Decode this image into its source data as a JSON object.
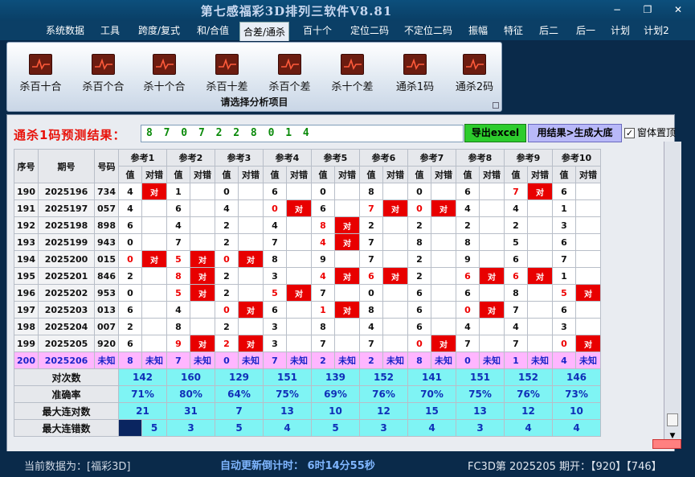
{
  "window": {
    "title": "第七感福彩3D排列三软件V8.81",
    "min": "−",
    "restore": "❐",
    "close": "✕"
  },
  "menu": [
    "系统数据",
    "工具",
    "跨度/复式",
    "和/合值",
    "合差/通杀",
    "百十个",
    "定位二码",
    "不定位二码",
    "振幅",
    "特征",
    "后二",
    "后一",
    "计划",
    "计划2"
  ],
  "menu_active": 4,
  "ribbon": {
    "buttons": [
      "杀百十合",
      "杀百个合",
      "杀十个合",
      "杀百十差",
      "杀百个差",
      "杀十个差",
      "通杀1码",
      "通杀2码"
    ],
    "caption": "请选择分析项目"
  },
  "result": {
    "label": "通杀1码预测结果：",
    "value": "8 7 0 7 2 2 8 0 1 4",
    "export_btn": "导出excel",
    "gen_btn": "用结果>生成大底",
    "topmost_label": "窗体置顶",
    "topmost_checked": "✓"
  },
  "table": {
    "headers": {
      "seq": "序号",
      "period": "期号",
      "number": "号码",
      "value": "值",
      "check": "对错"
    },
    "refs": [
      "参考1",
      "参考2",
      "参考3",
      "参考4",
      "参考5",
      "参考6",
      "参考7",
      "参考8",
      "参考9",
      "参考10"
    ],
    "ok_mark": "对",
    "rows": [
      {
        "seq": "190",
        "period": "2025196",
        "number": "734",
        "cells": [
          [
            "4",
            0,
            1
          ],
          [
            "1",
            0,
            0
          ],
          [
            "0",
            0,
            0
          ],
          [
            "6",
            0,
            0
          ],
          [
            "0",
            0,
            0
          ],
          [
            "8",
            0,
            0
          ],
          [
            "0",
            0,
            0
          ],
          [
            "6",
            0,
            0
          ],
          [
            "7",
            1,
            1
          ],
          [
            "6",
            0,
            0
          ]
        ]
      },
      {
        "seq": "191",
        "period": "2025197",
        "number": "057",
        "cells": [
          [
            "4",
            0,
            0
          ],
          [
            "6",
            0,
            0
          ],
          [
            "4",
            0,
            0
          ],
          [
            "0",
            1,
            1
          ],
          [
            "6",
            0,
            0
          ],
          [
            "7",
            1,
            1
          ],
          [
            "0",
            1,
            1
          ],
          [
            "4",
            0,
            0
          ],
          [
            "4",
            0,
            0
          ],
          [
            "1",
            0,
            0
          ]
        ]
      },
      {
        "seq": "192",
        "period": "2025198",
        "number": "898",
        "cells": [
          [
            "6",
            0,
            0
          ],
          [
            "4",
            0,
            0
          ],
          [
            "2",
            0,
            0
          ],
          [
            "4",
            0,
            0
          ],
          [
            "8",
            1,
            1
          ],
          [
            "2",
            0,
            0
          ],
          [
            "2",
            0,
            0
          ],
          [
            "2",
            0,
            0
          ],
          [
            "2",
            0,
            0
          ],
          [
            "3",
            0,
            0
          ]
        ]
      },
      {
        "seq": "193",
        "period": "2025199",
        "number": "943",
        "cells": [
          [
            "0",
            0,
            0
          ],
          [
            "7",
            0,
            0
          ],
          [
            "2",
            0,
            0
          ],
          [
            "7",
            0,
            0
          ],
          [
            "4",
            1,
            1
          ],
          [
            "7",
            0,
            0
          ],
          [
            "8",
            0,
            0
          ],
          [
            "8",
            0,
            0
          ],
          [
            "5",
            0,
            0
          ],
          [
            "6",
            0,
            0
          ]
        ]
      },
      {
        "seq": "194",
        "period": "2025200",
        "number": "015",
        "cells": [
          [
            "0",
            1,
            1
          ],
          [
            "5",
            1,
            1
          ],
          [
            "0",
            1,
            1
          ],
          [
            "8",
            0,
            0
          ],
          [
            "9",
            0,
            0
          ],
          [
            "7",
            0,
            0
          ],
          [
            "2",
            0,
            0
          ],
          [
            "9",
            0,
            0
          ],
          [
            "6",
            0,
            0
          ],
          [
            "7",
            0,
            0
          ]
        ]
      },
      {
        "seq": "195",
        "period": "2025201",
        "number": "846",
        "cells": [
          [
            "2",
            0,
            0
          ],
          [
            "8",
            1,
            1
          ],
          [
            "2",
            0,
            0
          ],
          [
            "3",
            0,
            0
          ],
          [
            "4",
            1,
            1
          ],
          [
            "6",
            1,
            1
          ],
          [
            "2",
            0,
            0
          ],
          [
            "6",
            1,
            1
          ],
          [
            "6",
            1,
            1
          ],
          [
            "1",
            0,
            0
          ]
        ]
      },
      {
        "seq": "196",
        "period": "2025202",
        "number": "953",
        "cells": [
          [
            "0",
            0,
            0
          ],
          [
            "5",
            1,
            1
          ],
          [
            "2",
            0,
            0
          ],
          [
            "5",
            1,
            1
          ],
          [
            "7",
            0,
            0
          ],
          [
            "0",
            0,
            0
          ],
          [
            "6",
            0,
            0
          ],
          [
            "6",
            0,
            0
          ],
          [
            "8",
            0,
            0
          ],
          [
            "5",
            1,
            1
          ]
        ]
      },
      {
        "seq": "197",
        "period": "2025203",
        "number": "013",
        "cells": [
          [
            "6",
            0,
            0
          ],
          [
            "4",
            0,
            0
          ],
          [
            "0",
            1,
            1
          ],
          [
            "6",
            0,
            0
          ],
          [
            "1",
            1,
            1
          ],
          [
            "8",
            0,
            0
          ],
          [
            "6",
            0,
            0
          ],
          [
            "0",
            1,
            1
          ],
          [
            "7",
            0,
            0
          ],
          [
            "6",
            0,
            0
          ]
        ]
      },
      {
        "seq": "198",
        "period": "2025204",
        "number": "007",
        "cells": [
          [
            "2",
            0,
            0
          ],
          [
            "8",
            0,
            0
          ],
          [
            "2",
            0,
            0
          ],
          [
            "3",
            0,
            0
          ],
          [
            "8",
            0,
            0
          ],
          [
            "4",
            0,
            0
          ],
          [
            "6",
            0,
            0
          ],
          [
            "4",
            0,
            0
          ],
          [
            "4",
            0,
            0
          ],
          [
            "3",
            0,
            0
          ]
        ]
      },
      {
        "seq": "199",
        "period": "2025205",
        "number": "920",
        "cells": [
          [
            "6",
            0,
            0
          ],
          [
            "9",
            1,
            1
          ],
          [
            "2",
            1,
            1
          ],
          [
            "3",
            0,
            0
          ],
          [
            "7",
            0,
            0
          ],
          [
            "7",
            0,
            0
          ],
          [
            "0",
            1,
            1
          ],
          [
            "7",
            0,
            0
          ],
          [
            "7",
            0,
            0
          ],
          [
            "0",
            1,
            1
          ]
        ]
      }
    ],
    "unknown_row": {
      "seq": "200",
      "period": "2025206",
      "number": "未知",
      "values": [
        "8",
        "7",
        "0",
        "7",
        "2",
        "2",
        "8",
        "0",
        "1",
        "4"
      ],
      "check": "未知"
    },
    "stats": [
      {
        "label": "对次数",
        "values": [
          "142",
          "160",
          "129",
          "151",
          "139",
          "152",
          "141",
          "151",
          "152",
          "146"
        ]
      },
      {
        "label": "准确率",
        "values": [
          "71%",
          "80%",
          "64%",
          "75%",
          "69%",
          "76%",
          "70%",
          "75%",
          "76%",
          "73%"
        ]
      },
      {
        "label": "最大连对数",
        "values": [
          "21",
          "31",
          "7",
          "13",
          "10",
          "12",
          "15",
          "13",
          "12",
          "10"
        ]
      },
      {
        "label": "最大连错数",
        "values": [
          "5",
          "3",
          "5",
          "4",
          "5",
          "3",
          "4",
          "3",
          "4",
          "4"
        ]
      }
    ]
  },
  "status": {
    "left": "当前数据为：[福彩3D]",
    "countdown": "自动更新倒计时：  6时14分55秒",
    "right": "FC3D第 2025205 期开：【920】【746】"
  }
}
